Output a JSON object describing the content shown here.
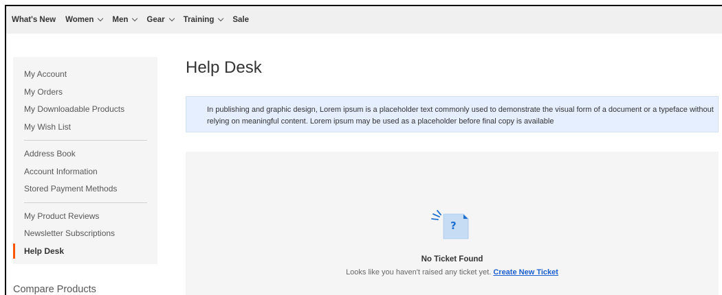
{
  "nav": {
    "items": [
      {
        "label": "What's New",
        "has_dropdown": false
      },
      {
        "label": "Women",
        "has_dropdown": true
      },
      {
        "label": "Men",
        "has_dropdown": true
      },
      {
        "label": "Gear",
        "has_dropdown": true
      },
      {
        "label": "Training",
        "has_dropdown": true
      },
      {
        "label": "Sale",
        "has_dropdown": false
      }
    ]
  },
  "sidebar": {
    "groups": [
      [
        "My Account",
        "My Orders",
        "My Downloadable Products",
        "My Wish List"
      ],
      [
        "Address Book",
        "Account Information",
        "Stored Payment Methods"
      ],
      [
        "My Product Reviews",
        "Newsletter Subscriptions",
        "Help Desk"
      ]
    ],
    "active": "Help Desk",
    "accent_color": "#ff5501"
  },
  "compare": {
    "title": "Compare Products"
  },
  "main": {
    "title": "Help Desk",
    "notice": "In publishing and graphic design, Lorem ipsum is a placeholder text commonly used to demonstrate the visual form of a document or a typeface without relying on meaningful content. Lorem ipsum may be used as a placeholder before final copy is available",
    "empty": {
      "icon": "ticket-question-icon",
      "title": "No Ticket Found",
      "text": "Looks like you haven't raised any ticket yet.",
      "link": "Create New Ticket"
    }
  }
}
